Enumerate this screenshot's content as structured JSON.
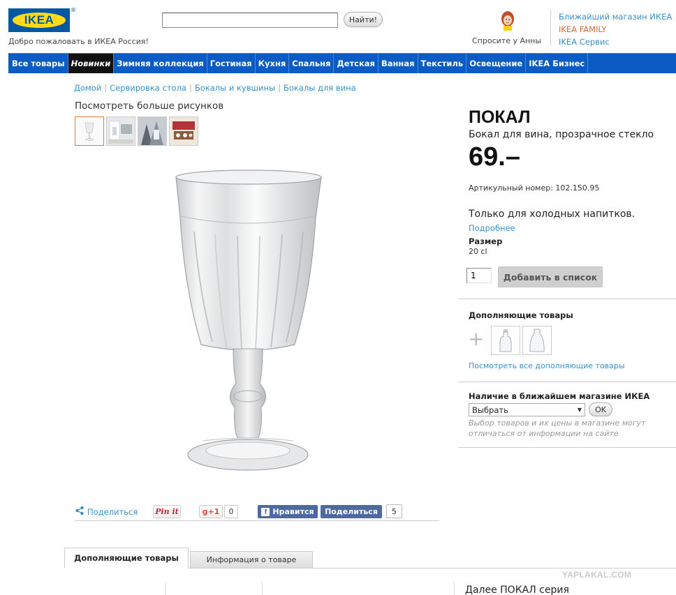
{
  "header": {
    "logo_text": "IKEA",
    "logo_reg": "®",
    "welcome": "Добро пожаловать в ИКЕА Россия!",
    "search": {
      "value": "",
      "placeholder": "",
      "button_label": "Найти!"
    },
    "ask_anna": "Спросите у Анны",
    "links": [
      {
        "label": "Ближайший магазин ИКЕА",
        "color": "#3a8fc7"
      },
      {
        "label": "IKEA FAMILY",
        "color": "#d26a3a"
      },
      {
        "label": "IKEA Сервис",
        "color": "#3a8fc7"
      }
    ]
  },
  "nav": {
    "items": [
      "Все товары",
      "Новинки",
      "Зимняя коллекция",
      "Гостиная",
      "Кухня",
      "Спальня",
      "Детская",
      "Ванная",
      "Текстиль",
      "Освещение",
      "IKEA Бизнес"
    ],
    "active_index": 1,
    "bg_color": "#0a5bc4"
  },
  "breadcrumb": [
    "Домой",
    "Сервировка стола",
    "Бокалы и кувшины",
    "Бокалы для вина"
  ],
  "gallery": {
    "more_images_label": "Посмотреть больше рисунков",
    "thumb_count": 4,
    "selected_index": 0
  },
  "product": {
    "name": "ПОКАЛ",
    "description": "Бокал для вина, прозрачное стекло",
    "price": "69.–",
    "article": "Артикульный номер: 102.150.95",
    "note": "Только для холодных напитков.",
    "more_link": "Подробнее",
    "size_label": "Размер",
    "size_value": "20 cl",
    "quantity": "1",
    "add_button": "Добавить в список"
  },
  "complementary": {
    "title": "Дополняющие товары",
    "plus": "+",
    "see_all": "Посмотреть все дополняющие товары"
  },
  "availability": {
    "title": "Наличие в ближайшем магазине ИКЕА",
    "select_value": "Выбрать",
    "ok_button": "OK",
    "note": "Выбор товаров и их цены в магазине могут отличаться от информации на сайте"
  },
  "share": {
    "share_label": "Поделиться",
    "pinit": "Pin it",
    "gplus": "g+1",
    "gplus_count": "0",
    "fb_like": "Нравится",
    "fb_share": "Поделиться",
    "fb_count": "5"
  },
  "tabs": [
    "Дополняющие товары",
    "Информация о товаре"
  ],
  "next_series": "Далее ПОКАЛ серия",
  "watermark": "YAPLAKAL.COM"
}
